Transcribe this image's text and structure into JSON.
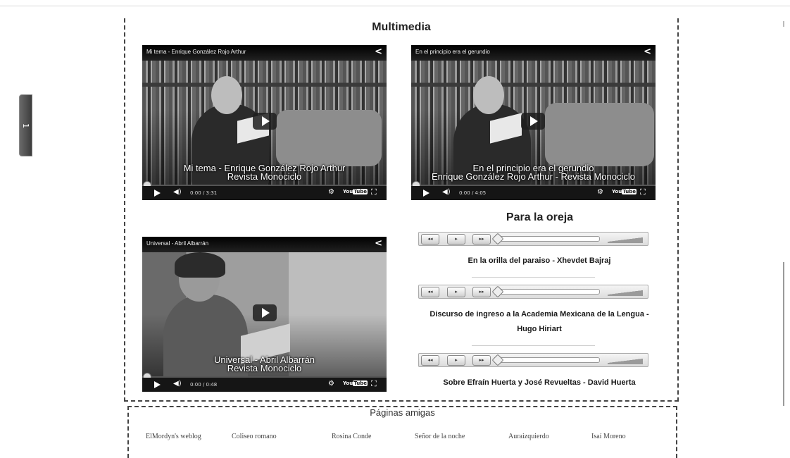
{
  "side_tab": {
    "label": "1"
  },
  "multimedia": {
    "title": "Multimedia",
    "videos": [
      {
        "top_title": "Mi tema - Enrique González Rojo Arthur",
        "overlay_line1": "Mi tema - Enrique González Rojo Arthur",
        "overlay_line2": "Revista Monociclo",
        "time": "0:00 / 3:31"
      },
      {
        "top_title": "En el principio era el gerundio",
        "overlay_line1": "En el principio era el gerundio",
        "overlay_line2": "Enrique González Rojo Arthur - Revista Monociclo",
        "time": "0:00 / 4:05"
      },
      {
        "top_title": "Universal - Abril Albarrán",
        "overlay_line1": "Universal - Abril Albarrán",
        "overlay_line2": "Revista Monociclo",
        "time": "0:00 / 0:48"
      }
    ]
  },
  "oreja": {
    "title": "Para la oreja",
    "tracks": [
      {
        "title": "En la orilla del paraiso - Xhevdet Bajraj"
      },
      {
        "title_line1": "Discurso de ingreso a la Academia Mexicana de la Lengua -",
        "title_line2": "Hugo Hiriart"
      },
      {
        "title": "Sobre Efraín Huerta y José Revueltas - David Huerta"
      }
    ],
    "player": {
      "rewind": "◂◂",
      "play": "▸",
      "forward": "▸▸"
    }
  },
  "friends": {
    "title": "Páginas amigas",
    "links": [
      "ElMordyn's weblog",
      "Coliseo romano",
      "Rosina Conde",
      "Señor de la noche",
      "Auraizquierdo",
      "Isaí Moreno"
    ]
  },
  "icons": {
    "share": "share-icon",
    "volume": "volume-icon",
    "gear": "gear-icon",
    "youtube": "youtube-logo",
    "fullscreen": "fullscreen-icon"
  },
  "youtube_logo": {
    "you": "You",
    "tube": "Tube"
  }
}
